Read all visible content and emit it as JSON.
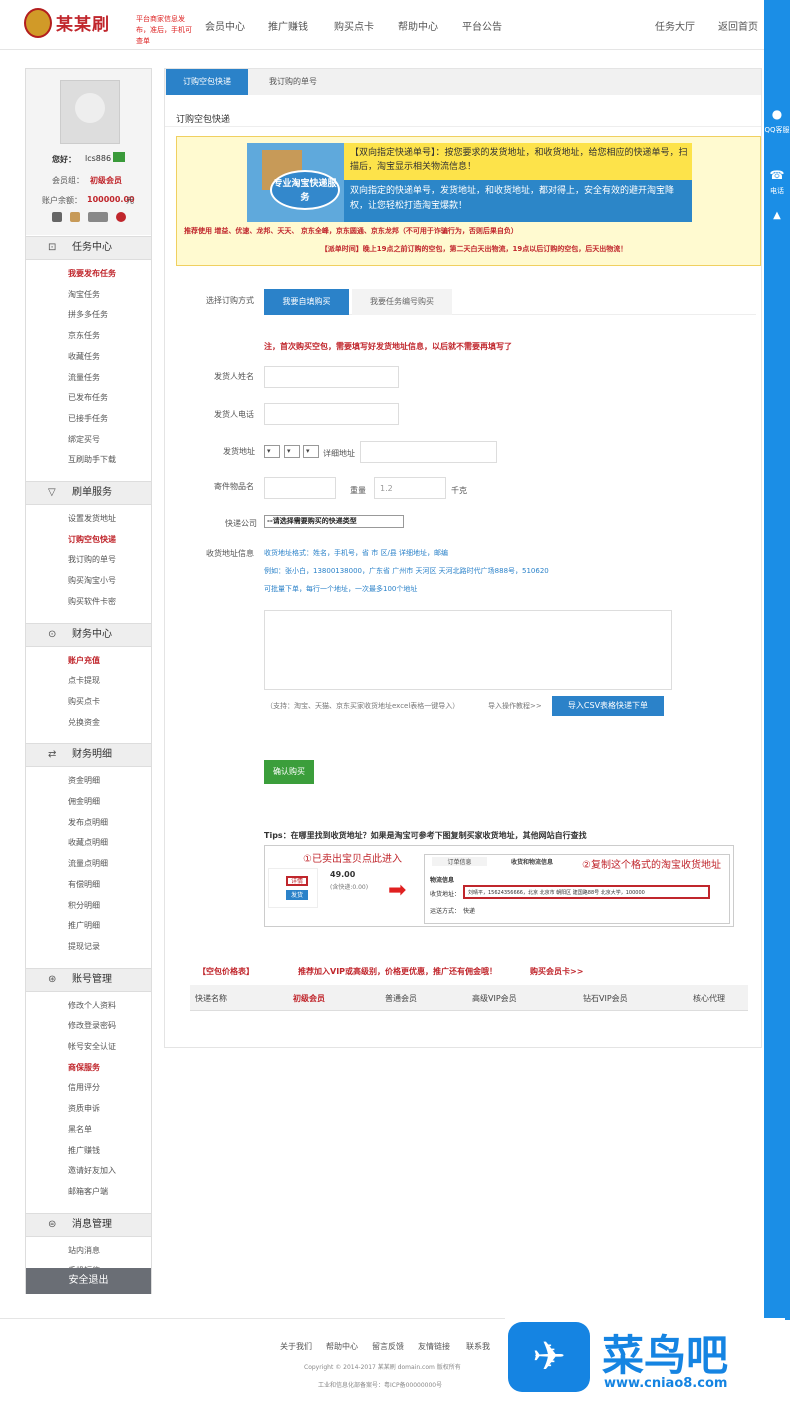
{
  "header": {
    "logo": "某某刷",
    "slogan": "平台商家信息发布，准后，手机可查单",
    "nav": [
      "会员中心",
      "推广赚钱",
      "购买点卡",
      "帮助中心",
      "平台公告"
    ],
    "right": [
      "任务大厅",
      "返回首页"
    ]
  },
  "rail": {
    "qq": "QQ客服",
    "phone": "电话"
  },
  "sidebar": {
    "greeting": "您好：",
    "username": "lcs886",
    "level_label": "会员组：",
    "level": "初级会员",
    "balance_label": "账户余额：",
    "balance": "100000.00",
    "unit": "元",
    "sections": [
      {
        "title": "任务中心",
        "icon": "⊡",
        "items": [
          {
            "label": "我要发布任务",
            "hl": true
          },
          {
            "label": "淘宝任务"
          },
          {
            "label": "拼多多任务"
          },
          {
            "label": "京东任务"
          },
          {
            "label": "收藏任务"
          },
          {
            "label": "流量任务"
          },
          {
            "label": "已发布任务"
          },
          {
            "label": "已接手任务"
          },
          {
            "label": "绑定买号"
          },
          {
            "label": "互刷助手下载"
          }
        ]
      },
      {
        "title": "刷单服务",
        "icon": "▽",
        "items": [
          {
            "label": "设置发货地址"
          },
          {
            "label": "订购空包快递",
            "hl": true
          },
          {
            "label": "我订购的单号"
          },
          {
            "label": "购买淘宝小号"
          },
          {
            "label": "购买软件卡密"
          }
        ]
      },
      {
        "title": "财务中心",
        "icon": "⊙",
        "items": [
          {
            "label": "账户充值",
            "hl": true
          },
          {
            "label": "点卡提现"
          },
          {
            "label": "购买点卡"
          },
          {
            "label": "兑换资金"
          }
        ]
      },
      {
        "title": "财务明细",
        "icon": "⇄",
        "items": [
          {
            "label": "资金明细"
          },
          {
            "label": "佣金明细"
          },
          {
            "label": "发布点明细"
          },
          {
            "label": "收藏点明细"
          },
          {
            "label": "流量点明细"
          },
          {
            "label": "有偿明细"
          },
          {
            "label": "积分明细"
          },
          {
            "label": "推广明细"
          },
          {
            "label": "提现记录"
          }
        ]
      },
      {
        "title": "账号管理",
        "icon": "⊛",
        "items": [
          {
            "label": "修改个人资料"
          },
          {
            "label": "修改登录密码"
          },
          {
            "label": "帐号安全认证"
          },
          {
            "label": "商保服务",
            "hl": true
          },
          {
            "label": "信用评分"
          },
          {
            "label": "资质申诉"
          },
          {
            "label": "黑名单"
          },
          {
            "label": "推广赚钱"
          },
          {
            "label": "邀请好友加入"
          },
          {
            "label": "邮箱客户端"
          }
        ]
      },
      {
        "title": "消息管理",
        "icon": "⊜",
        "items": [
          {
            "label": "站内消息"
          },
          {
            "label": "手机短信"
          }
        ]
      }
    ],
    "logout": "安全退出"
  },
  "main": {
    "tabs": [
      "订购空包快递",
      "我订购的单号"
    ],
    "title": "订购空包快递",
    "promo_top": "【双向指定快递单号】：按您要求的发货地址，和收货地址，给您相应的快递单号，扫描后，淘宝显示相关物流信息！",
    "promo_bottom": "双向指定的快递单号，发货地址，和收货地址，都对得上，安全有效的避开淘宝降权，让您轻松打造淘宝爆款！",
    "promo_badge": "专业淘宝快递服务",
    "rec_line": "推荐使用 增益、优速、龙邦、天天、 京东全峰，京东圆通、京东龙邦（不可用于诈骗行为，否则后果自负）",
    "time_line": "【派单时间】晚上19点之前订购的空包，第二天白天出物流，19点以后订购的空包，后天出物流！",
    "form": {
      "method_label": "选择订购方式",
      "method_tabs": [
        "我要自填购买",
        "我要任务编号购买"
      ],
      "first_tip": "注，首次购买空包，需要填写好发货地址信息，以后就不需要再填写了",
      "sender_name": "发货人姓名",
      "sender_phone": "发货人电话",
      "sender_addr": "发货地址",
      "detail_addr": "详细地址",
      "item_name": "寄件物品名",
      "weight_label": "重量",
      "weight_value": "1.2",
      "weight_unit": "千克",
      "courier_label": "快递公司",
      "courier_value": "--请选择需要购买的快递类型",
      "recv_label": "收货地址信息",
      "recv_fmt": "收货地址格式：姓名，手机号，省 市 区/县 详细地址，邮编",
      "recv_example": "例如：张小白，13800138000，广东省 广州市 天河区 天河北路时代广场888号，510620",
      "recv_note": "可批量下单，每行一个地址，一次最多100个地址",
      "support": "（支持：淘宝、天猫、京东买家收货地址excel表格一键导入）",
      "guide": "导入操作教程>>",
      "import_btn": "导入CSV表格快递下单",
      "submit": "确认购买"
    },
    "tips": "Tips：在哪里找到收货地址？如果是淘宝可参考下图复制买家收货地址，其他网站自行查找",
    "tip1": "①已卖出宝贝点此进入",
    "tip2": "②复制这个格式的淘宝收货地址",
    "tip_tab1": "订单信息",
    "tip_tab2": "收货和物流信息",
    "tip_price": "49.00",
    "tip_sub": "(含快递:0.00)",
    "tip_btns": [
      "详情",
      "发货"
    ],
    "tip_logistic": "物流信息",
    "tip_addr_label": "收货地址：",
    "tip_addr": "刘晴平，15624356666，北京 北京市 朝阳区 建国路88号 北京大学，100000",
    "tip_way_label": "运送方式：",
    "tip_way": "快递",
    "price_title": "【空包价格表】",
    "price_vip": "推荐加入VIP或高级别，价格更优惠，推广还有佣金哦！",
    "price_buy": "购买会员卡>>",
    "price_cols": [
      "快递名称",
      "初级会员",
      "普通会员",
      "高级VIP会员",
      "钻石VIP会员",
      "核心代理"
    ]
  },
  "footer": {
    "links": [
      "关于我们",
      "帮助中心",
      "留言反馈",
      "友情链接",
      "联系我"
    ],
    "copyright": "Copyright © 2014-2017 某某刷 domain.com 版权所有",
    "icp": "工业和信息化部备案号：粤ICP备00000000号"
  },
  "watermark": {
    "text": "菜鸟吧",
    "url": "www.cniao8.com"
  }
}
